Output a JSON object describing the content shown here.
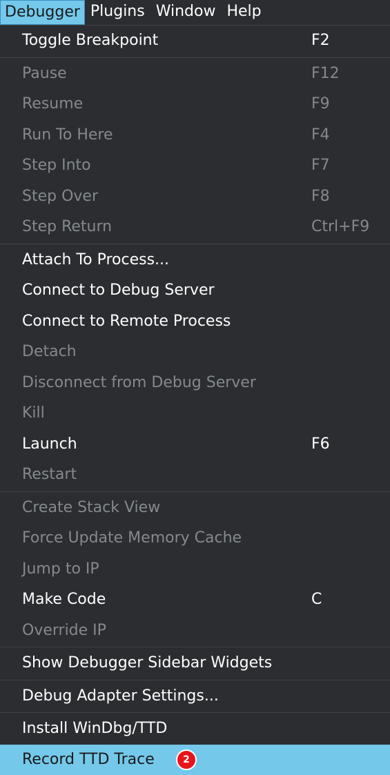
{
  "menubar": {
    "items": [
      {
        "label": "Debugger",
        "active": true
      },
      {
        "label": "Plugins"
      },
      {
        "label": "Window"
      },
      {
        "label": "Help"
      }
    ]
  },
  "menu": {
    "groups": [
      [
        {
          "label": "Toggle Breakpoint",
          "shortcut": "F2",
          "enabled": true
        }
      ],
      [
        {
          "label": "Pause",
          "shortcut": "F12",
          "enabled": false
        },
        {
          "label": "Resume",
          "shortcut": "F9",
          "enabled": false
        },
        {
          "label": "Run To Here",
          "shortcut": "F4",
          "enabled": false
        },
        {
          "label": "Step Into",
          "shortcut": "F7",
          "enabled": false
        },
        {
          "label": "Step Over",
          "shortcut": "F8",
          "enabled": false
        },
        {
          "label": "Step Return",
          "shortcut": "Ctrl+F9",
          "enabled": false
        }
      ],
      [
        {
          "label": "Attach To Process...",
          "shortcut": "",
          "enabled": true
        },
        {
          "label": "Connect to Debug Server",
          "shortcut": "",
          "enabled": true
        },
        {
          "label": "Connect to Remote Process",
          "shortcut": "",
          "enabled": true
        },
        {
          "label": "Detach",
          "shortcut": "",
          "enabled": false
        },
        {
          "label": "Disconnect from Debug Server",
          "shortcut": "",
          "enabled": false
        },
        {
          "label": "Kill",
          "shortcut": "",
          "enabled": false
        },
        {
          "label": "Launch",
          "shortcut": "F6",
          "enabled": true
        },
        {
          "label": "Restart",
          "shortcut": "",
          "enabled": false
        }
      ],
      [
        {
          "label": "Create Stack View",
          "shortcut": "",
          "enabled": false
        },
        {
          "label": "Force Update Memory Cache",
          "shortcut": "",
          "enabled": false
        },
        {
          "label": "Jump to IP",
          "shortcut": "",
          "enabled": false
        },
        {
          "label": "Make Code",
          "shortcut": "C",
          "enabled": true
        },
        {
          "label": "Override IP",
          "shortcut": "",
          "enabled": false
        }
      ],
      [
        {
          "label": "Show Debugger Sidebar Widgets",
          "shortcut": "",
          "enabled": true
        }
      ],
      [
        {
          "label": "Debug Adapter Settings...",
          "shortcut": "",
          "enabled": true
        }
      ],
      [
        {
          "label": "Install WinDbg/TTD",
          "shortcut": "",
          "enabled": true
        },
        {
          "label": "Record TTD Trace",
          "shortcut": "",
          "enabled": true,
          "highlighted": true,
          "badge": "2"
        }
      ]
    ]
  },
  "colors": {
    "background": "#2b2d30",
    "highlight": "#74c8ea",
    "text": "#ffffff",
    "disabled_text": "#85898d",
    "badge": "#e8141b"
  }
}
